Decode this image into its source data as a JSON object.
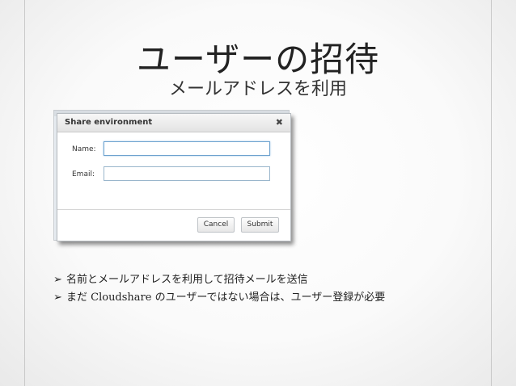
{
  "slide": {
    "title": "ユーザーの招待",
    "subtitle": "メールアドレスを利用"
  },
  "dialog": {
    "title": "Share environment",
    "close_icon": "✖",
    "fields": {
      "name_label": "Name:",
      "name_value": "",
      "email_label": "Email:",
      "email_value": ""
    },
    "buttons": {
      "cancel": "Cancel",
      "submit": "Submit"
    }
  },
  "bullets": {
    "marker": "➢",
    "items": [
      "名前とメールアドレスを利用して招待メールを送信",
      "まだ Cloudshare のユーザーではない場合は、ユーザー登録が必要"
    ]
  }
}
